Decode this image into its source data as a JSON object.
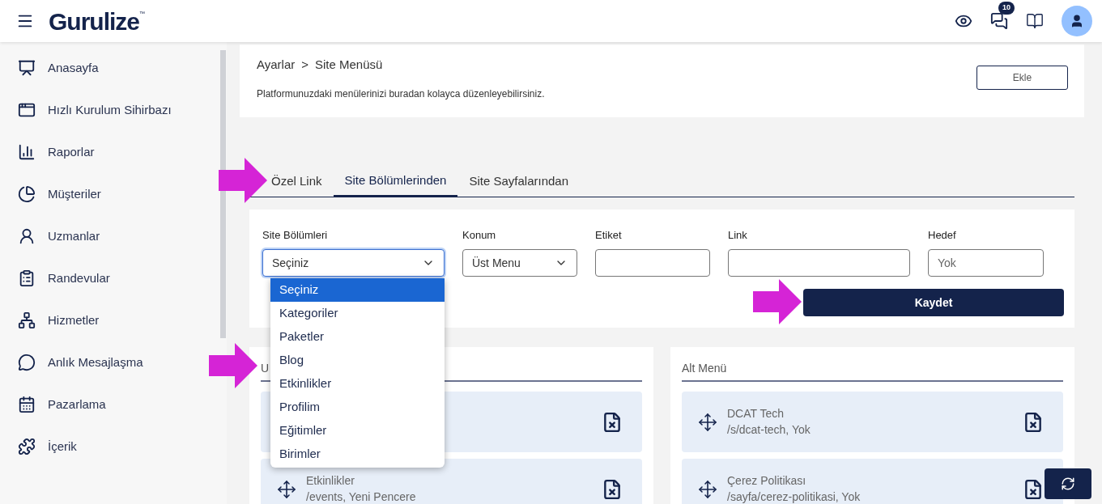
{
  "header": {
    "logo": "Gurulize",
    "logo_mark": "™",
    "messages_badge": "10"
  },
  "sidebar": {
    "items": [
      {
        "label": "Anasayfa"
      },
      {
        "label": "Hızlı Kurulum Sihirbazı"
      },
      {
        "label": "Raporlar"
      },
      {
        "label": "Müşteriler"
      },
      {
        "label": "Uzmanlar"
      },
      {
        "label": "Randevular"
      },
      {
        "label": "Hizmetler"
      },
      {
        "label": "Anlık Mesajlaşma"
      },
      {
        "label": "Pazarlama"
      },
      {
        "label": "İçerik"
      }
    ]
  },
  "page_header": {
    "breadcrumb": [
      "Ayarlar",
      "Site Menüsü"
    ],
    "separator": ">",
    "description": "Platformunuzdaki menülerinizi buradan kolayca düzenleyebilirsiniz.",
    "add_button": "Ekle"
  },
  "tabs": [
    {
      "label": "Özel Link",
      "selected": false
    },
    {
      "label": "Site Bölümlerinden",
      "selected": true
    },
    {
      "label": "Site Sayfalarından",
      "selected": false
    }
  ],
  "form": {
    "fields": [
      {
        "label": "Site Bölümleri",
        "kind": "select",
        "value": "Seçiniz",
        "expanded": true
      },
      {
        "label": "Konum",
        "kind": "select",
        "value": "Üst Menu",
        "expanded": false
      },
      {
        "label": "Etiket",
        "kind": "input"
      },
      {
        "label": "Link",
        "kind": "input"
      },
      {
        "label": "Hedef",
        "kind": "input",
        "placeholder": "Yok"
      }
    ],
    "options": [
      {
        "label": "Seçiniz",
        "selected": true
      },
      {
        "label": "Kategoriler",
        "selected": false
      },
      {
        "label": "Paketler",
        "selected": false
      },
      {
        "label": "Blog",
        "selected": false
      },
      {
        "label": "Etkinlikler",
        "selected": false
      },
      {
        "label": "Profilim",
        "selected": false
      },
      {
        "label": "Eğitimler",
        "selected": false
      },
      {
        "label": "Birimler",
        "selected": false
      }
    ],
    "save_button": "Kaydet"
  },
  "panels": [
    {
      "title": "U",
      "items": [
        {
          "kind": "covered"
        },
        {
          "kind": "entry",
          "title": "Etkinlikler",
          "subtitle": "/events, Yeni Pencere"
        }
      ]
    },
    {
      "title": "Alt Menü",
      "items": [
        {
          "kind": "entry",
          "title": "DCAT Tech",
          "subtitle": "/s/dcat-tech, Yok"
        },
        {
          "kind": "entry",
          "title": "Çerez Politikası",
          "subtitle": "/sayfa/cerez-politikasi, Yok"
        }
      ]
    }
  ]
}
